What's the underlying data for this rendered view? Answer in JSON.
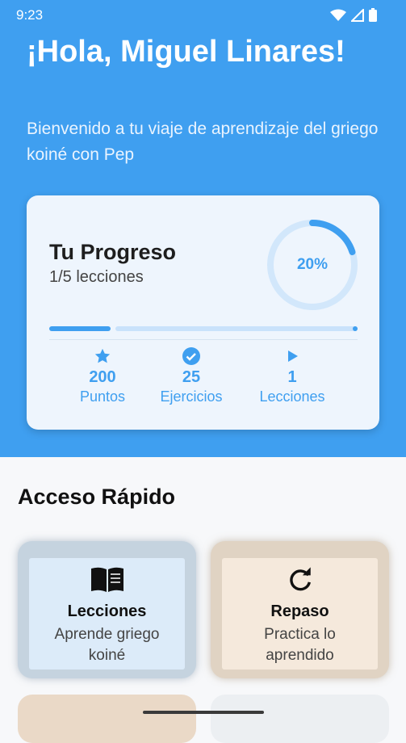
{
  "status_bar": {
    "time": "9:23"
  },
  "header": {
    "greeting": "¡Hola, Miguel Linares!",
    "subtitle": "Bienvenido a tu viaje de aprendizaje del griego koiné con Pep"
  },
  "progress": {
    "title": "Tu Progreso",
    "lessons_text": "1/5 lecciones",
    "percent_label": "20%",
    "fraction": 0.2,
    "stats": [
      {
        "icon": "star-icon",
        "value": "200",
        "label": "Puntos"
      },
      {
        "icon": "check-circle-icon",
        "value": "25",
        "label": "Ejercicios"
      },
      {
        "icon": "play-icon",
        "value": "1",
        "label": "Lecciones"
      }
    ]
  },
  "quick_access": {
    "title": "Acceso Rápido",
    "tiles": [
      {
        "icon": "book-icon",
        "title": "Lecciones",
        "desc": "Aprende griego koiné"
      },
      {
        "icon": "refresh-icon",
        "title": "Repaso",
        "desc": "Practica lo aprendido"
      }
    ]
  },
  "colors": {
    "accent": "#3f9ff0",
    "tile_blue": "#dcebf9",
    "tile_beige": "#f5e9dc"
  }
}
